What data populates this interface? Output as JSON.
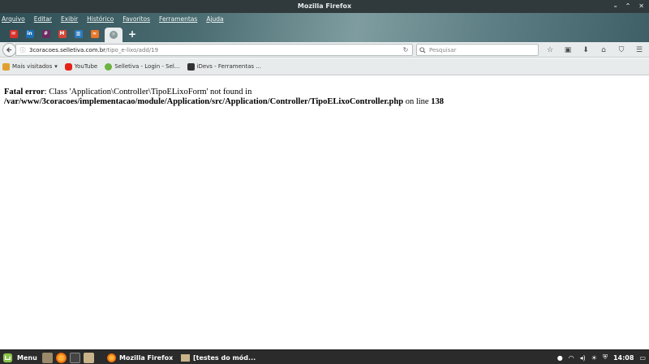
{
  "window": {
    "title": "Mozilla Firefox"
  },
  "menubar": {
    "items": [
      "Arquivo",
      "Editar",
      "Exibir",
      "Histórico",
      "Favoritos",
      "Ferramentas",
      "Ajuda"
    ]
  },
  "tabs": {
    "pinned": [
      {
        "icon": "red-mail-icon",
        "color": "#d9312b"
      },
      {
        "icon": "linkedin-icon",
        "color": "#1b6fb5",
        "glyph": "in"
      },
      {
        "icon": "slack-icon",
        "color": "#6b2b60"
      },
      {
        "icon": "gmail-icon",
        "color": "#d44638"
      },
      {
        "icon": "trello-icon",
        "color": "#2d7bc0"
      },
      {
        "icon": "link-orange-icon",
        "color": "#e8762b"
      },
      {
        "icon": "active-tab-favicon",
        "color": "#8a9a9c"
      }
    ],
    "new_tab_label": "+"
  },
  "navbar": {
    "url_domain": "3coracoes.selletiva.com.br",
    "url_path": "/tipo_e-lixo/add/19",
    "search_placeholder": "Pesquisar"
  },
  "bookmarks": [
    {
      "label": "Mais visitados",
      "icon": "folder-icon",
      "color": "#e0a030"
    },
    {
      "label": "YouTube",
      "icon": "youtube-icon",
      "color": "#e62117"
    },
    {
      "label": "Selletiva - Login - Sel...",
      "icon": "selletiva-icon",
      "color": "#6cb33f"
    },
    {
      "label": "iDevs - Ferramentas ...",
      "icon": "idevs-icon",
      "color": "#333333"
    }
  ],
  "error": {
    "prefix": "Fatal error",
    "message": ": Class 'Application\\Controller\\TipoELixoForm' not found in ",
    "path": "/var/www/3coracoes/implementacao/module/Application/src/Application/Controller/TipoELixoController.php",
    "line_prefix": " on line ",
    "line_number": "138"
  },
  "taskbar": {
    "menu_label": "Menu",
    "tasks": [
      {
        "label": "Mozilla Firefox",
        "icon": "firefox-icon"
      },
      {
        "label": "[testes do mód...",
        "icon": "folder-icon"
      }
    ],
    "clock": "14:08"
  }
}
